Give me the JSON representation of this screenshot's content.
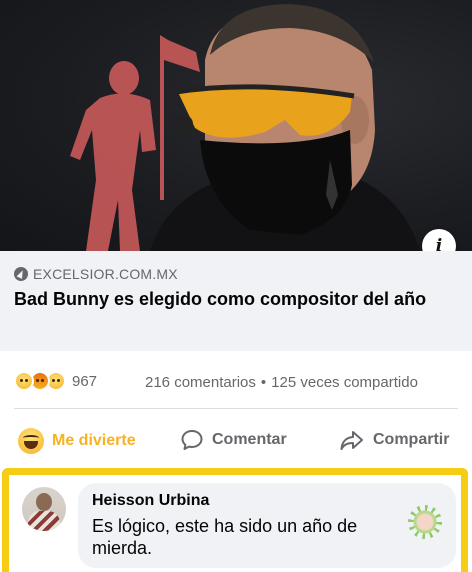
{
  "link_preview": {
    "domain": "EXCELSIOR.COM.MX",
    "headline": "Bad Bunny es elegido como compositor del año",
    "info_glyph": "i",
    "image_icon": "photo-portrait-sunglasses-mask"
  },
  "reactions": {
    "icons": [
      "haha-icon",
      "angry-icon",
      "sad-icon"
    ],
    "count": "967",
    "comments": "216 comentarios",
    "separator": "•",
    "shares": "125 veces compartido"
  },
  "actions": {
    "react_label": "Me divierte",
    "comment_label": "Comentar",
    "share_label": "Compartir"
  },
  "comment": {
    "author": "Heisson Urbina",
    "text": "Es lógico, este ha sido un año  de mierda.",
    "sticker_icon": "sun-face-icon"
  },
  "colors": {
    "highlight_frame": "#f5cd14",
    "react_active": "#f7b125",
    "muted_text": "#65676b",
    "bubble_bg": "#f0f2f5"
  }
}
